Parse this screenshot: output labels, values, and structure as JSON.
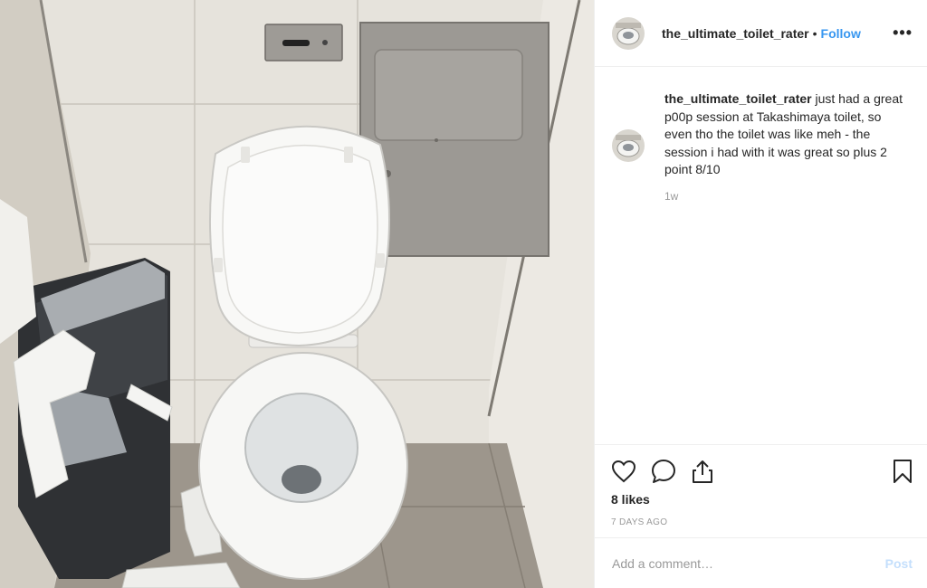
{
  "post": {
    "username": "the_ultimate_toilet_rater",
    "follow_label": "Follow",
    "header_dot": "•",
    "more_label": "•••",
    "caption_text": " just had a great p00p session at Takashimaya toilet, so even tho the toilet was like meh - the session i had with it was great so plus 2 point 8/10",
    "time_ago": "1w",
    "likes": "8 likes",
    "date": "7 DAYS AGO"
  },
  "comment_box": {
    "placeholder": "Add a comment…",
    "post_label": "Post"
  },
  "icons": {
    "like": "heart-icon",
    "comment": "comment-icon",
    "share": "share-icon",
    "save": "bookmark-icon",
    "more": "more-options-icon"
  },
  "colors": {
    "link": "#3897f0",
    "post_disabled": "#c4dffc",
    "muted": "#999999",
    "border": "#efefef"
  }
}
